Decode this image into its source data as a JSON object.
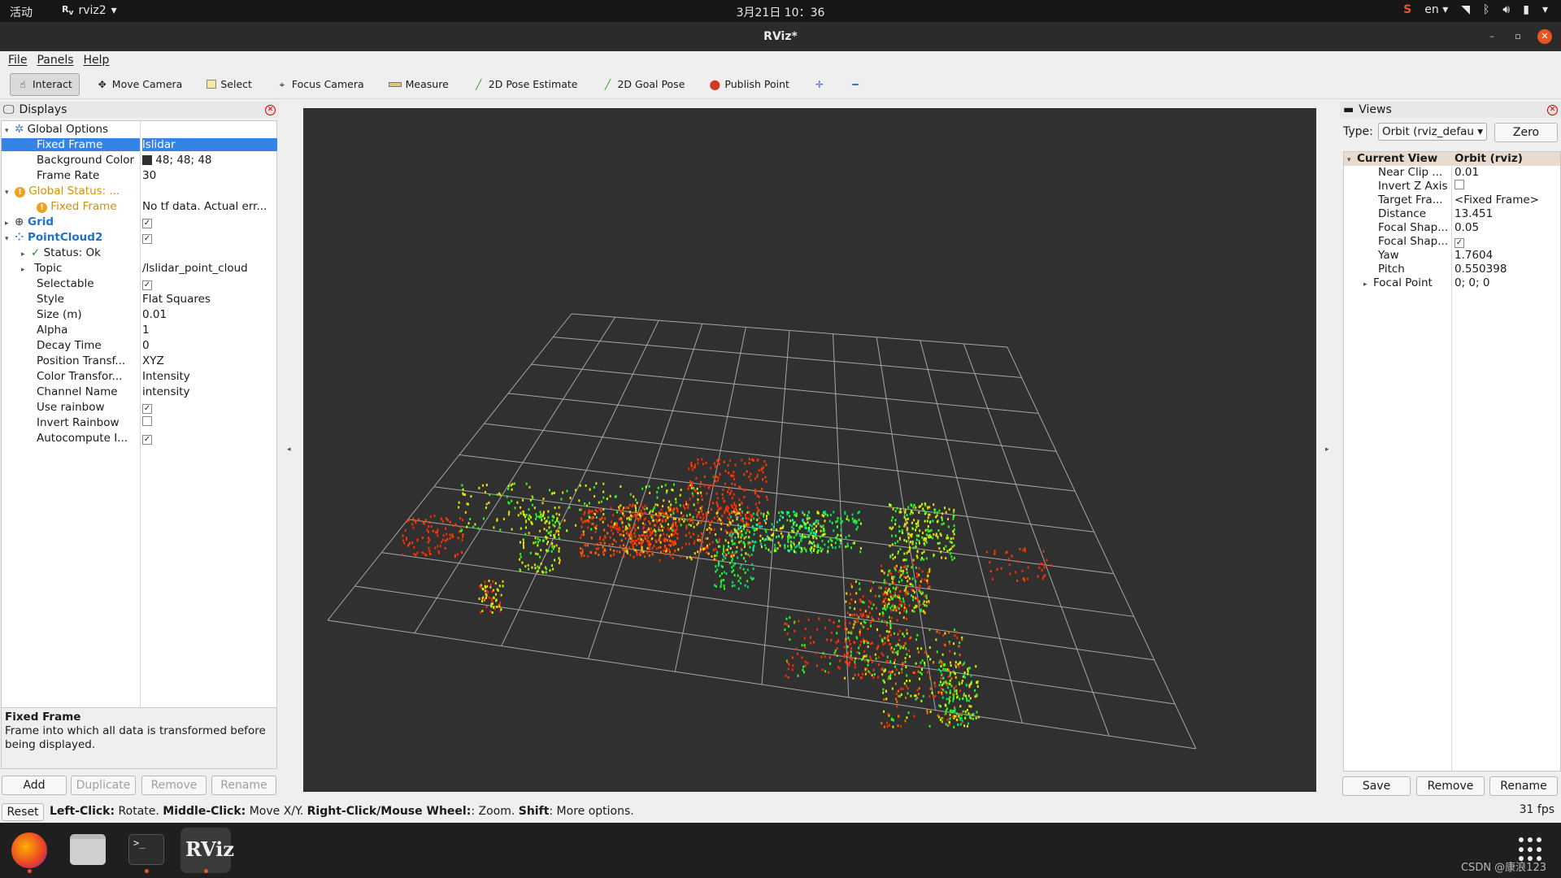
{
  "topbar": {
    "activities": "活动",
    "app_name": "rviz2",
    "clock": "3月21日 10：36",
    "lang": "en"
  },
  "window": {
    "title": "RViz*"
  },
  "menu": [
    "File",
    "Panels",
    "Help"
  ],
  "toolbar": {
    "interact": "Interact",
    "move_camera": "Move Camera",
    "select": "Select",
    "focus_camera": "Focus Camera",
    "measure": "Measure",
    "pose_estimate": "2D Pose Estimate",
    "goal_pose": "2D Goal Pose",
    "publish_point": "Publish Point"
  },
  "displays": {
    "title": "Displays",
    "rows": {
      "global_options": "Global Options",
      "fixed_frame": {
        "name": "Fixed Frame",
        "value": "lslidar"
      },
      "background_color": {
        "name": "Background Color",
        "value": "48; 48; 48"
      },
      "frame_rate": {
        "name": "Frame Rate",
        "value": "30"
      },
      "global_status": "Global Status: ...",
      "status_fixed_frame": {
        "name": "Fixed Frame",
        "value": "No tf data.  Actual err..."
      },
      "grid": "Grid",
      "pointcloud2": "PointCloud2",
      "status_ok": "Status: Ok",
      "topic": {
        "name": "Topic",
        "value": "/lslidar_point_cloud"
      },
      "selectable": "Selectable",
      "style": {
        "name": "Style",
        "value": "Flat Squares"
      },
      "size": {
        "name": "Size (m)",
        "value": "0.01"
      },
      "alpha": {
        "name": "Alpha",
        "value": "1"
      },
      "decay": {
        "name": "Decay Time",
        "value": "0"
      },
      "position": {
        "name": "Position Transf...",
        "value": "XYZ"
      },
      "color_transformer": {
        "name": "Color Transfor...",
        "value": "Intensity"
      },
      "channel": {
        "name": "Channel Name",
        "value": "intensity"
      },
      "use_rainbow": "Use rainbow",
      "invert_rainbow": "Invert Rainbow",
      "autocompute": "Autocompute I..."
    },
    "description": {
      "title": "Fixed Frame",
      "text": "Frame into which all data is transformed before being displayed."
    },
    "buttons": {
      "add": "Add",
      "duplicate": "Duplicate",
      "remove": "Remove",
      "rename": "Rename"
    }
  },
  "views": {
    "title": "Views",
    "type_label": "Type:",
    "type_value": "Orbit (rviz_defau",
    "zero": "Zero",
    "header": {
      "name": "Current View",
      "value": "Orbit (rviz)"
    },
    "rows": [
      {
        "name": "Near Clip ...",
        "value": "0.01"
      },
      {
        "name": "Invert Z Axis",
        "value": ""
      },
      {
        "name": "Target Fra...",
        "value": "<Fixed Frame>"
      },
      {
        "name": "Distance",
        "value": "13.451"
      },
      {
        "name": "Focal Shap...",
        "value": "0.05"
      },
      {
        "name": "Focal Shap...",
        "value": ""
      },
      {
        "name": "Yaw",
        "value": "1.7604"
      },
      {
        "name": "Pitch",
        "value": "0.550398"
      },
      {
        "name": "Focal Point",
        "value": "0; 0; 0"
      }
    ],
    "buttons": {
      "save": "Save",
      "remove": "Remove",
      "rename": "Rename"
    }
  },
  "statusbar": {
    "reset": "Reset",
    "left_click": "Left-Click:",
    "left_click_text": " Rotate. ",
    "middle_click": "Middle-Click:",
    "middle_click_text": " Move X/Y. ",
    "right_click": "Right-Click/Mouse Wheel:",
    "right_click_text": ": Zoom. ",
    "shift": "Shift",
    "shift_text": ": More options.",
    "fps": "31 fps"
  },
  "dock": {
    "watermark": "CSDN @康浪123",
    "rviz_label": "RViz"
  },
  "colors": {
    "background": "#303030",
    "grid": "#a0a0a0",
    "selection": "#3584e4",
    "accent": "#e95420"
  }
}
